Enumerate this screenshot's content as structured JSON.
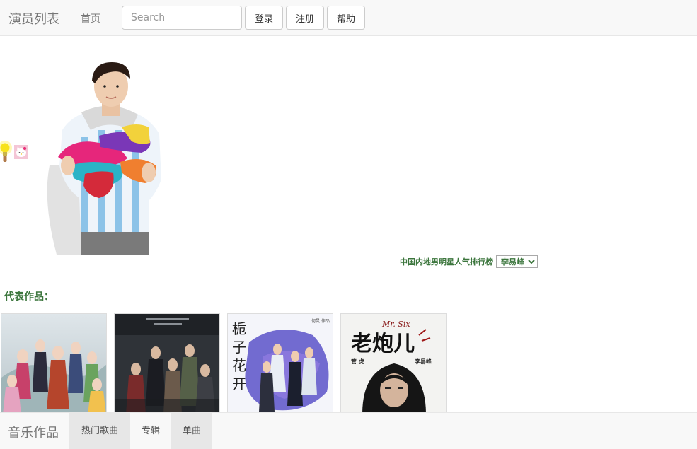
{
  "navbar": {
    "brand": "演员列表",
    "home": "首页",
    "search_placeholder": "Search",
    "login": "登录",
    "register": "注册",
    "help": "帮助"
  },
  "ranking": {
    "label": "中国内地男明星人气排行榜",
    "selected": "李易峰"
  },
  "works": {
    "heading": "代表作品：",
    "posters": [
      {
        "caption": ""
      },
      {
        "caption": ""
      },
      {
        "caption": "栀子花开",
        "side_text": "何炅  作品"
      },
      {
        "caption": "老炮儿",
        "title_en": "Mr. Six",
        "credit_left": "管 虎",
        "credit_right": "李易峰"
      }
    ]
  },
  "bottom_nav": {
    "brand": "音乐作品",
    "items": [
      "热门歌曲",
      "专辑",
      "单曲"
    ]
  },
  "colors": {
    "accent_green": "#3c763d",
    "navbar_bg": "#f8f8f8",
    "active_tab_bg": "#e7e7e7"
  }
}
